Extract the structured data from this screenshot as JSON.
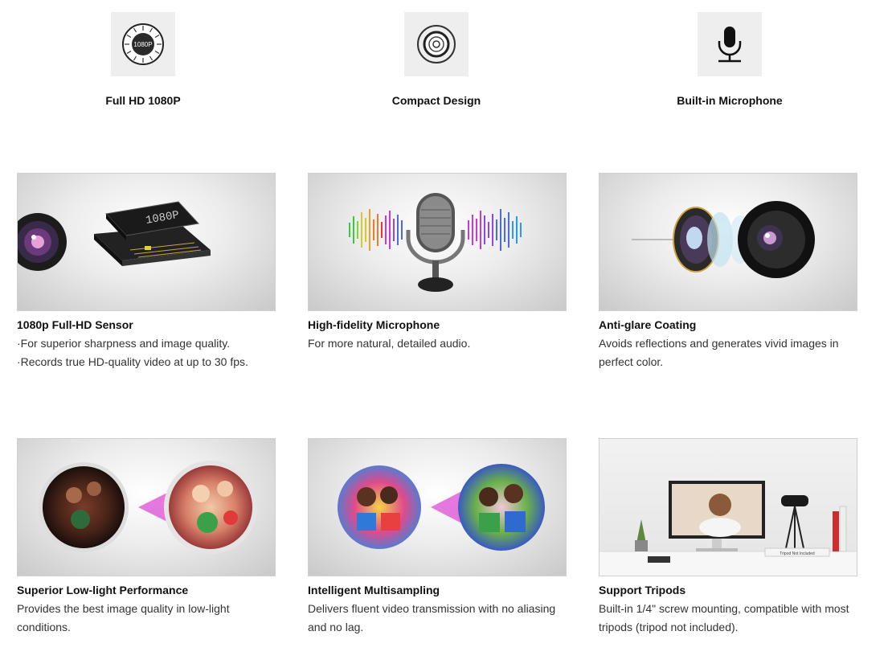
{
  "features": [
    {
      "label": "Full HD 1080P",
      "icon": "hd-1080p-icon",
      "icon_text": "1080P"
    },
    {
      "label": "Compact Design",
      "icon": "lens-icon"
    },
    {
      "label": "Built-in Microphone",
      "icon": "microphone-icon"
    }
  ],
  "cards": [
    {
      "title": "1080p Full-HD Sensor",
      "desc": "·For superior sharpness and image quality.\n·Records true HD-quality video at up to 30 fps.",
      "image": "sensor-chip-image",
      "chip_text": "1080P"
    },
    {
      "title": "High-fidelity Microphone",
      "desc": "For more natural, detailed audio.",
      "image": "microphone-soundwave-image"
    },
    {
      "title": "Anti-glare Coating",
      "desc": "Avoids reflections and generates vivid images in\nperfect color.",
      "image": "lens-coating-image"
    },
    {
      "title": "Superior Low-light Performance",
      "desc": "Provides the best image quality in low-light\nconditions.",
      "image": "low-light-comparison-image"
    },
    {
      "title": "Intelligent Multisampling",
      "desc": "Delivers fluent video transmission with no aliasing\nand no lag.",
      "image": "multisampling-comparison-image"
    },
    {
      "title": "Support Tripods",
      "desc": "Built-in 1/4\" screw mounting, compatible with most\ntripods (tripod not included).",
      "image": "tripod-desk-image",
      "box_text": "Tripod Not Included"
    }
  ],
  "colors": {
    "icon_bg": "#eeeeee",
    "card_border": "#cfcfcf",
    "accent_magenta": "#e040d0"
  }
}
